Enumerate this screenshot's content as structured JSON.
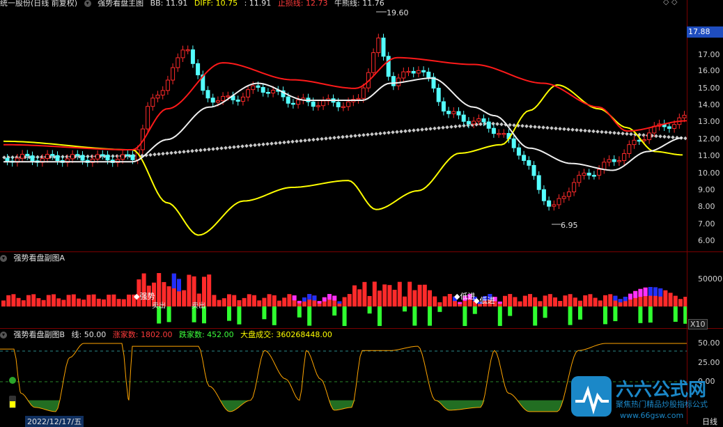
{
  "main": {
    "title": "统一股份(日线 前复权)",
    "indicator_name": "强势看盘主图",
    "bb_label": "BB: 11.91",
    "diff_label": "DIFF: 10.75",
    "extra_label": ": 11.91",
    "stop_label": "止损线: 12.73",
    "bull_label": "牛熊线: 11.76",
    "high_mark": "19.60",
    "low_mark": "6.95",
    "current_price": "17.88",
    "axis": [
      "17.00",
      "16.00",
      "15.00",
      "14.00",
      "13.00",
      "12.00",
      "11.00",
      "10.00",
      "9.00",
      "8.00",
      "7.00",
      "6.00"
    ]
  },
  "sub_a": {
    "title": "强势看盘副图A",
    "axis_top": "50000",
    "axis_bottom": "X10",
    "label_strong": "强势",
    "label_buy1": "低进",
    "label_buy2": "低进",
    "label_out1": "卖出",
    "label_out2": "卖出"
  },
  "sub_b": {
    "title": "强势看盘副图B",
    "line_label": "线: 50.00",
    "up_label": "涨家数: 1802.00",
    "down_label": "跌家数: 452.00",
    "vol_label": "大盘成交: 360268448.00",
    "axis": [
      "50.00",
      "25.00",
      "0.00"
    ]
  },
  "footer": {
    "date_label": "2022/12/17/五",
    "corner": "日线"
  },
  "watermark": {
    "brand": "六六公式网",
    "slogan": "聚焦热门精品炒股指标公式",
    "url": "www.66gsw.com"
  },
  "colors": {
    "up": "#ff2a2a",
    "down": "#54ffff",
    "ma_red": "#ff1a1a",
    "ma_white": "#f0f0f0",
    "ma_yellow": "#ffff00",
    "dots": "#c8c8c8",
    "vol_blue": "#2030ff",
    "vol_magenta": "#ff30ff",
    "vol_green": "#30ff30"
  }
}
